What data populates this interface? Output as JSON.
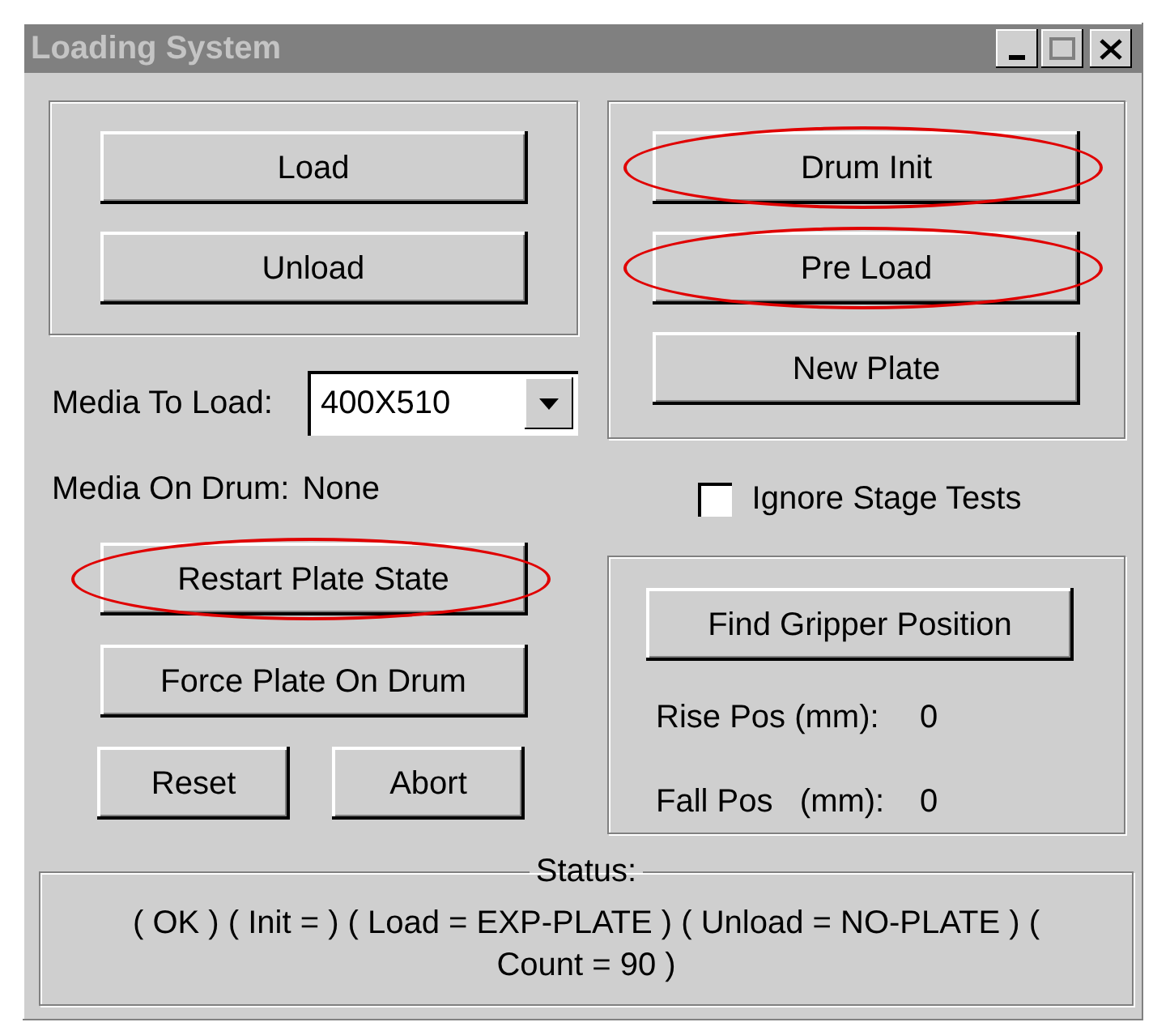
{
  "window": {
    "title": "Loading System"
  },
  "load_group": {
    "buttons": [
      {
        "label": "Load",
        "highlighted": false
      },
      {
        "label": "Unload",
        "highlighted": false
      }
    ]
  },
  "media_to_load": {
    "label": "Media To Load:",
    "value": "400X510"
  },
  "media_on_drum": {
    "label": "Media On Drum:",
    "value": "None"
  },
  "plate_buttons": [
    {
      "label": "Restart Plate State",
      "highlighted": true
    },
    {
      "label": "Force Plate On Drum",
      "highlighted": false
    }
  ],
  "bottom_buttons": [
    {
      "label": "Reset",
      "highlighted": false
    },
    {
      "label": "Abort",
      "highlighted": false
    }
  ],
  "drum_group": {
    "buttons": [
      {
        "label": "Drum Init",
        "highlighted": true
      },
      {
        "label": "Pre Load",
        "highlighted": true
      },
      {
        "label": "New Plate",
        "highlighted": false
      }
    ]
  },
  "ignore_stage_tests": {
    "label": "Ignore Stage Tests",
    "checked": false
  },
  "gripper_group": {
    "button": {
      "label": "Find Gripper Position",
      "highlighted": false
    },
    "rise": {
      "label": "Rise Pos (mm):",
      "value": "0"
    },
    "fall": {
      "label": "Fall Pos   (mm):",
      "value": "0"
    }
  },
  "status": {
    "legend": "Status:",
    "text": "( OK ) ( Init = ) ( Load = EXP-PLATE ) ( Unload = NO-PLATE ) ( Count = 90 )"
  }
}
